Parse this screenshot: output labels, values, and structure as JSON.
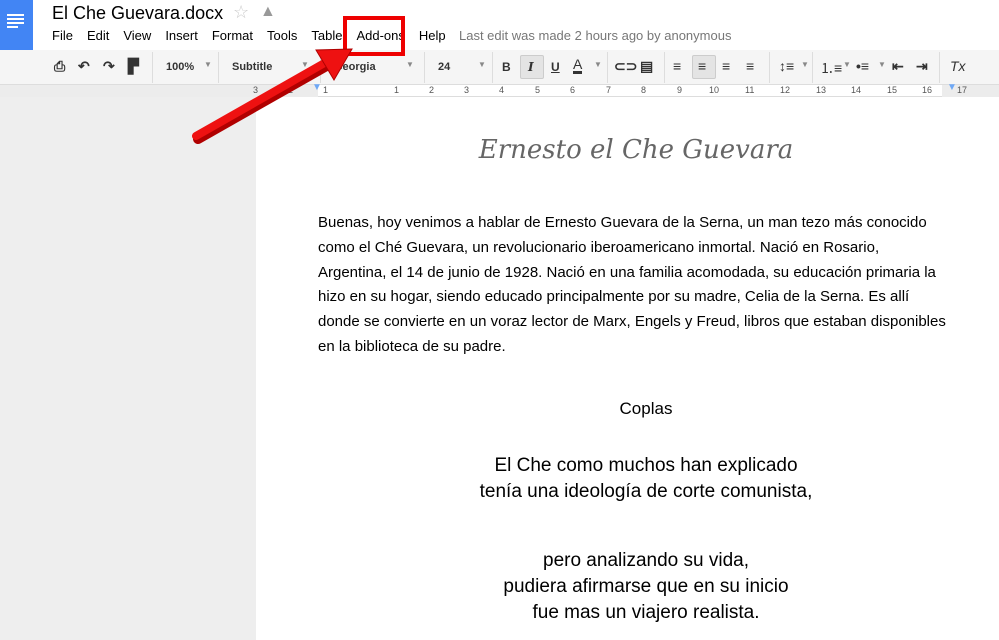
{
  "header": {
    "title": "El Che Guevara.docx",
    "last_edit": "Last edit was made 2 hours ago by anonymous"
  },
  "menu": [
    "File",
    "Edit",
    "View",
    "Insert",
    "Format",
    "Tools",
    "Table",
    "Add-ons",
    "Help"
  ],
  "toolbar": {
    "zoom": "100%",
    "style": "Subtitle",
    "font": "Georgia",
    "size": "24",
    "bold": "B",
    "italic": "I",
    "underline": "U",
    "text_color": "A",
    "clear_format": "Tx"
  },
  "ruler": [
    "3",
    "2",
    "1",
    "1",
    "2",
    "3",
    "4",
    "5",
    "6",
    "7",
    "8",
    "9",
    "10",
    "11",
    "12",
    "13",
    "14",
    "15",
    "16",
    "17"
  ],
  "doc": {
    "title": "Ernesto el Che Guevara",
    "paragraph": "Buenas, hoy venimos a hablar de Ernesto Guevara de la Serna, un man tezo más conocido como el Ché Guevara, un revolucionario iberoamericano inmortal. Nació en Rosario, Argentina, el  14 de junio de 1928. Nació en una familia acomodada, su educación primaria la hizo en su hogar, siendo educado principalmente por su madre, Celia de la Serna. Es allí donde se convierte en un voraz lector de Marx, Engels y Freud, libros que  estaban disponibles en la biblioteca de su padre.",
    "coplas": "Coplas",
    "stanza1": [
      "El Che como muchos han explicado",
      "tenía una ideología de corte comunista,"
    ],
    "stanza2": [
      "pero analizando su vida,",
      "pudiera afirmarse que en su inicio",
      "fue mas un viajero realista."
    ]
  },
  "colors": {
    "highlight": "#e00000",
    "brand": "#4285f4"
  }
}
